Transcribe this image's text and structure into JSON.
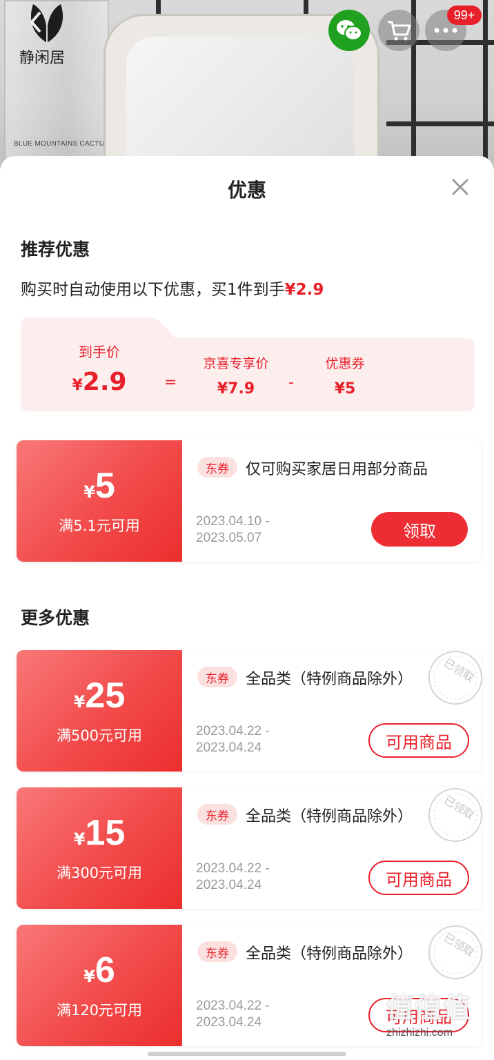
{
  "header": {
    "brand_name": "静闲居",
    "jar_label": "BLUE MOUNTAINS CACTUS",
    "message_badge": "99+"
  },
  "sheet": {
    "title": "优惠"
  },
  "recommended": {
    "section_title": "推荐优惠",
    "desc_prefix": "购买时自动使用以下优惠，买1件到手",
    "desc_price": "¥2.9",
    "breakdown": {
      "final_label": "到手价",
      "final_yen": "¥",
      "final_value": "2.9",
      "equals": "=",
      "exclusive_label": "京喜专享价",
      "exclusive_value": "¥7.9",
      "minus": "-",
      "coupon_label": "优惠券",
      "coupon_value": "¥5"
    },
    "coupon": {
      "yen": "¥",
      "amount": "5",
      "threshold": "满5.1元可用",
      "tag": "东券",
      "scope": "仅可购买家居日用部分商品",
      "date_start": "2023.04.10  -",
      "date_end": "2023.05.07",
      "button": "领取"
    }
  },
  "more": {
    "section_title": "更多优惠",
    "stamp": "已领取",
    "coupons": [
      {
        "yen": "¥",
        "amount": "25",
        "threshold": "满500元可用",
        "tag": "东券",
        "scope": "全品类（特例商品除外）",
        "date_start": "2023.04.22  -",
        "date_end": "2023.04.24",
        "button": "可用商品"
      },
      {
        "yen": "¥",
        "amount": "15",
        "threshold": "满300元可用",
        "tag": "东券",
        "scope": "全品类（特例商品除外）",
        "date_start": "2023.04.22  -",
        "date_end": "2023.04.24",
        "button": "可用商品"
      },
      {
        "yen": "¥",
        "amount": "6",
        "threshold": "满120元可用",
        "tag": "东券",
        "scope": "全品类（特例商品除外）",
        "date_start": "2023.04.22  -",
        "date_end": "2023.04.24",
        "button": "可用商品"
      }
    ]
  },
  "watermark": {
    "big": "值值值",
    "small": "zhizhizhi.com"
  },
  "colors": {
    "accent": "#e8202a",
    "coupon_gradient_start": "#f97878",
    "coupon_gradient_end": "#ec2e2e",
    "panel_bg": "#fdeeee",
    "wechat": "#1fa01f"
  }
}
